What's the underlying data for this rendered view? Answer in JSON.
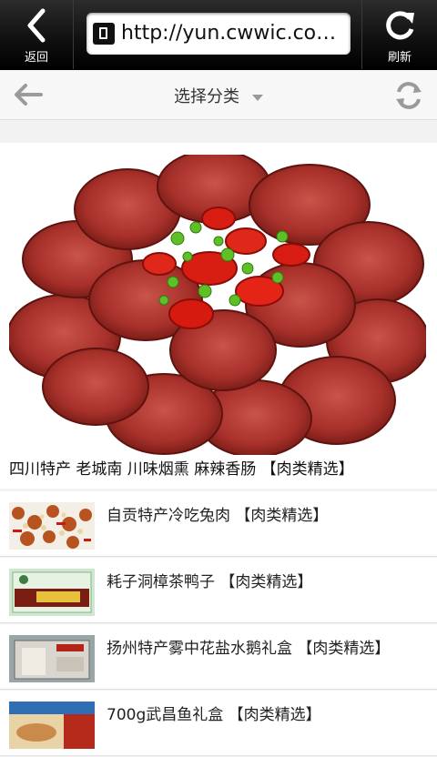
{
  "browser": {
    "back_label": "返回",
    "url": "http://yun.cwwic.com...",
    "refresh_label": "刷新"
  },
  "category_bar": {
    "title": "选择分类"
  },
  "featured": {
    "caption": "四川特产 老城南 川味烟熏 麻辣香肠 【肉类精选】"
  },
  "items": [
    {
      "name": "自贡特产冷吃兔肉 【肉类精选】"
    },
    {
      "name": "耗子洞樟茶鸭子 【肉类精选】"
    },
    {
      "name": "扬州特产雾中花盐水鹅礼盒 【肉类精选】"
    },
    {
      "name": "700g武昌鱼礼盒 【肉类精选】"
    }
  ],
  "colors": {
    "top_bar": "#111111",
    "sausage": "#a8322c",
    "chili": "#d81d12",
    "scallion": "#5fbf27"
  }
}
